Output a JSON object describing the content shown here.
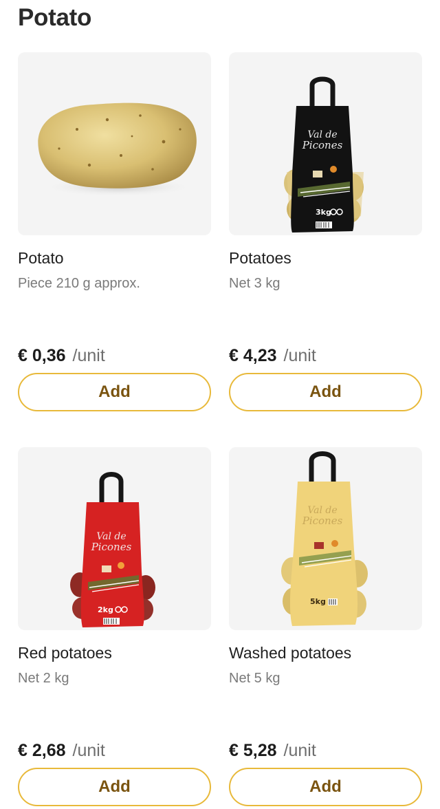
{
  "category": {
    "title": "Potato"
  },
  "products": [
    {
      "name": "Potato",
      "description": "Piece 210 g approx.",
      "price": "€ 0,36",
      "unit": "/unit",
      "add_label": "Add",
      "image": "single-potato"
    },
    {
      "name": "Potatoes",
      "description": "Net 3 kg",
      "price": "€ 4,23",
      "unit": "/unit",
      "add_label": "Add",
      "image": "potato-bag-black",
      "bag_weight": "3kg",
      "bag_brand": "Val de Picones"
    },
    {
      "name": "Red potatoes",
      "description": "Net 2 kg",
      "price": "€ 2,68",
      "unit": "/unit",
      "add_label": "Add",
      "image": "potato-bag-red",
      "bag_weight": "2kg",
      "bag_brand": "Val de Picones"
    },
    {
      "name": "Washed potatoes",
      "description": "Net 5 kg",
      "price": "€ 5,28",
      "unit": "/unit",
      "add_label": "Add",
      "image": "potato-bag-yellow",
      "bag_weight": "5kg",
      "bag_brand": "Val de Picones"
    }
  ],
  "colors": {
    "accent_border": "#e8b93a",
    "button_text": "#7a5410",
    "image_background": "#f4f4f4"
  }
}
